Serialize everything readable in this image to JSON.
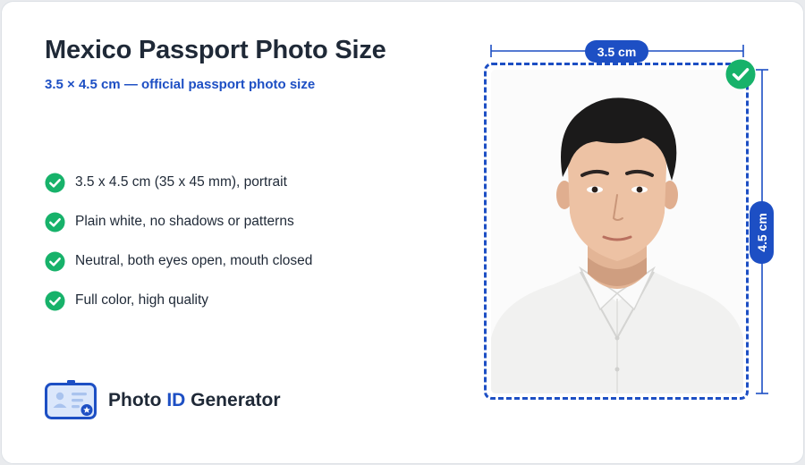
{
  "header": {
    "title": "Mexico Passport Photo Size",
    "subtitle": "3.5 × 4.5 cm — official passport photo size"
  },
  "requirements": [
    {
      "text": "3.5 x 4.5 cm (35 x 45 mm), portrait",
      "icon": "check-circle-icon"
    },
    {
      "text": "Plain white, no shadows or patterns",
      "icon": "check-circle-icon"
    },
    {
      "text": "Neutral, both eyes open, mouth closed",
      "icon": "check-circle-icon"
    },
    {
      "text": "Full color, high quality",
      "icon": "check-circle-icon"
    }
  ],
  "brand": {
    "name_part1": "Photo",
    "name_accent": "ID",
    "name_part2": "Generator",
    "icon": "id-card-icon"
  },
  "photo": {
    "width_label": "3.5 cm",
    "height_label": "4.5 cm",
    "status_icon": "verified-check-icon"
  },
  "colors": {
    "accent_blue": "#1d4fc4",
    "check_green": "#17b26a",
    "text_dark": "#1f2937"
  }
}
